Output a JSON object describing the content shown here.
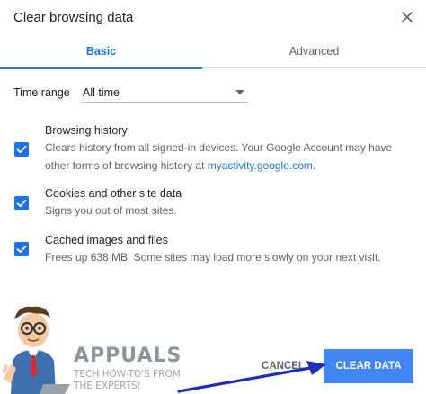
{
  "dialog": {
    "title": "Clear browsing data"
  },
  "tabs": [
    {
      "label": "Basic",
      "active": true
    },
    {
      "label": "Advanced",
      "active": false
    }
  ],
  "time_range": {
    "label": "Time range",
    "value": "All time"
  },
  "items": [
    {
      "title": "Browsing history",
      "description": "Clears history from all signed-in devices. Your Google Account may have other forms of browsing history at ",
      "link": "myactivity.google.com",
      "description_suffix": ".",
      "checked": true
    },
    {
      "title": "Cookies and other site data",
      "description": "Signs you out of most sites.",
      "checked": true
    },
    {
      "title": "Cached images and files",
      "description": "Frees up 638 MB. Some sites may load more slowly on your next visit.",
      "checked": true
    }
  ],
  "buttons": {
    "cancel": "CANCEL",
    "clear": "CLEAR DATA"
  },
  "watermark": {
    "brand": "APPUALS",
    "tagline_1": "TECH HOW-TO'S FROM",
    "tagline_2": "THE EXPERTS!"
  },
  "colors": {
    "accent": "#1a73e8",
    "primary_button": "#4285f4",
    "annotation_arrow": "#1c2fb8"
  }
}
